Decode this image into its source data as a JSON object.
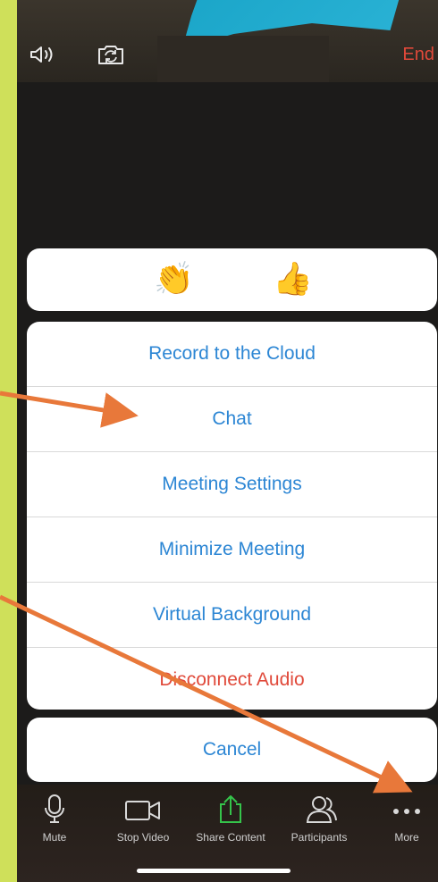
{
  "topbar": {
    "speaker_icon": "speaker-icon",
    "camera_switch_icon": "camera-switch-icon",
    "end_label": "End"
  },
  "reactions": [
    {
      "emoji": "👏",
      "name": "clap-reaction"
    },
    {
      "emoji": "👍",
      "name": "thumbs-up-reaction"
    }
  ],
  "menu": {
    "items": [
      {
        "label": "Record to the Cloud"
      },
      {
        "label": "Chat"
      },
      {
        "label": "Meeting Settings"
      },
      {
        "label": "Minimize Meeting"
      },
      {
        "label": "Virtual Background"
      },
      {
        "label": "Disconnect Audio"
      }
    ],
    "cancel_label": "Cancel"
  },
  "toolbar": {
    "items": [
      {
        "label": "Mute",
        "icon": "microphone-icon"
      },
      {
        "label": "Stop Video",
        "icon": "video-camera-icon"
      },
      {
        "label": "Share Content",
        "icon": "share-icon"
      },
      {
        "label": "Participants",
        "icon": "participants-icon"
      },
      {
        "label": "More",
        "icon": "more-dots-icon"
      }
    ]
  },
  "colors": {
    "accent_blue": "#2c86d4",
    "danger_red": "#e0493a",
    "share_green": "#35c44b",
    "annotation_orange": "#e8783a",
    "frame_green": "#cfe05a"
  }
}
